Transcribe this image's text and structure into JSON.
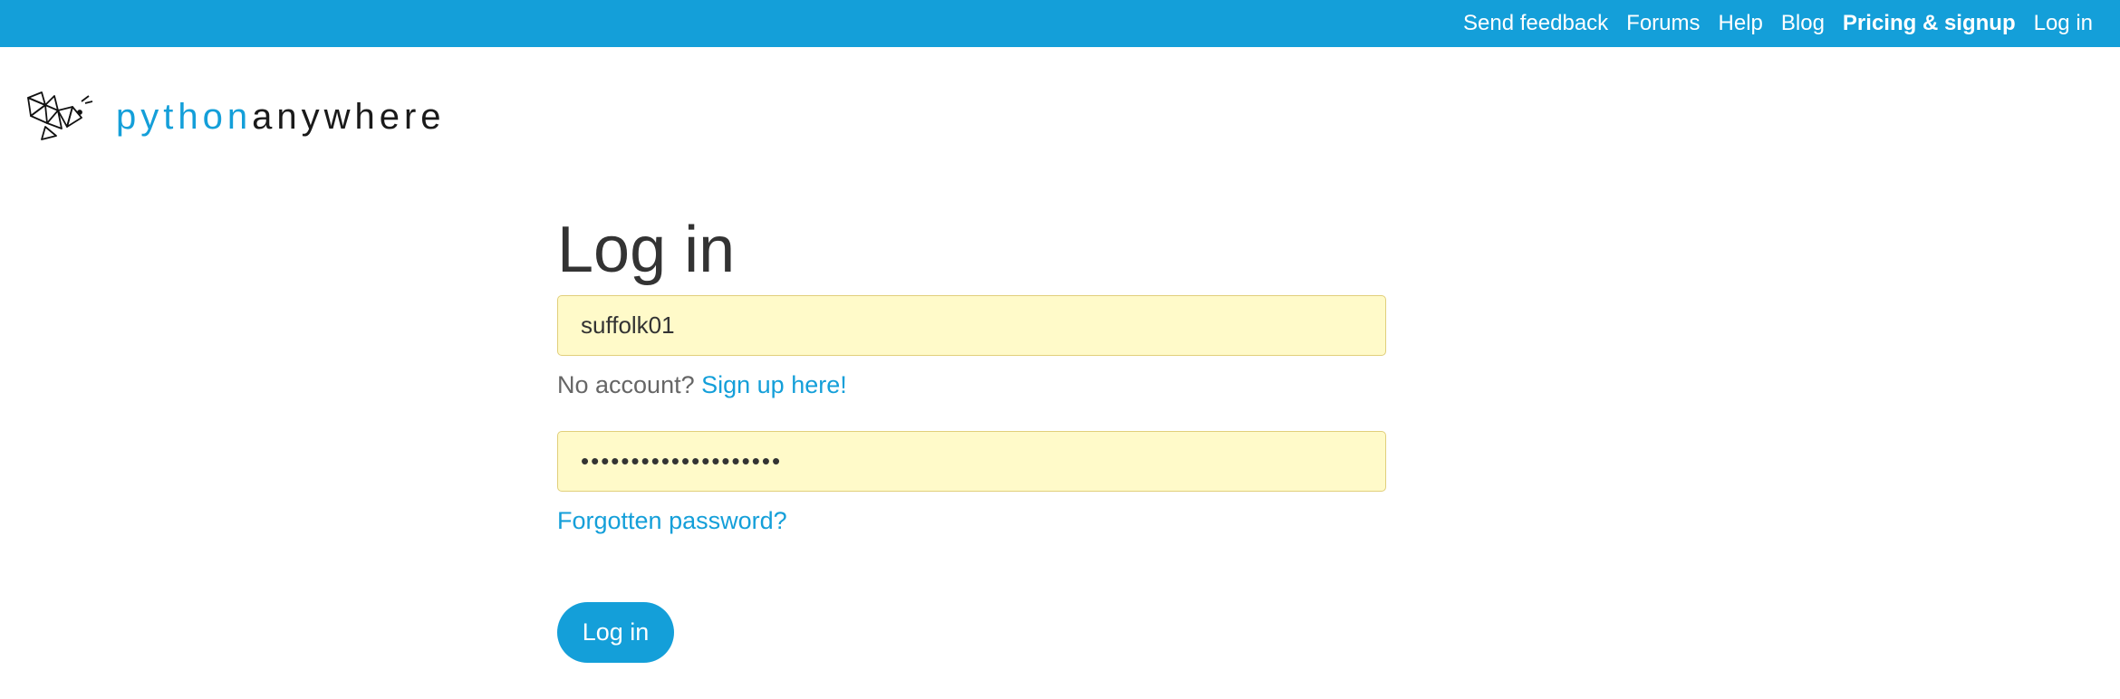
{
  "topnav": {
    "items": [
      {
        "label": "Send feedback"
      },
      {
        "label": "Forums"
      },
      {
        "label": "Help"
      },
      {
        "label": "Blog"
      },
      {
        "label": "Pricing & signup",
        "bold": true
      },
      {
        "label": "Log in"
      }
    ]
  },
  "logo": {
    "icon": "pythonanywhere-logo-icon",
    "text_python": "python",
    "text_anywhere": "anywhere"
  },
  "login": {
    "title": "Log in",
    "username_value": "suffolk01",
    "no_account_text": "No account?",
    "signup_link": "Sign up here!",
    "password_masked": "••••••••••••••••••••",
    "forgot_link": "Forgotten password?",
    "submit_label": "Log in"
  },
  "colors": {
    "accent": "#149fd9",
    "autofill_bg": "#fffac9",
    "text": "#333333",
    "muted": "#666666"
  }
}
